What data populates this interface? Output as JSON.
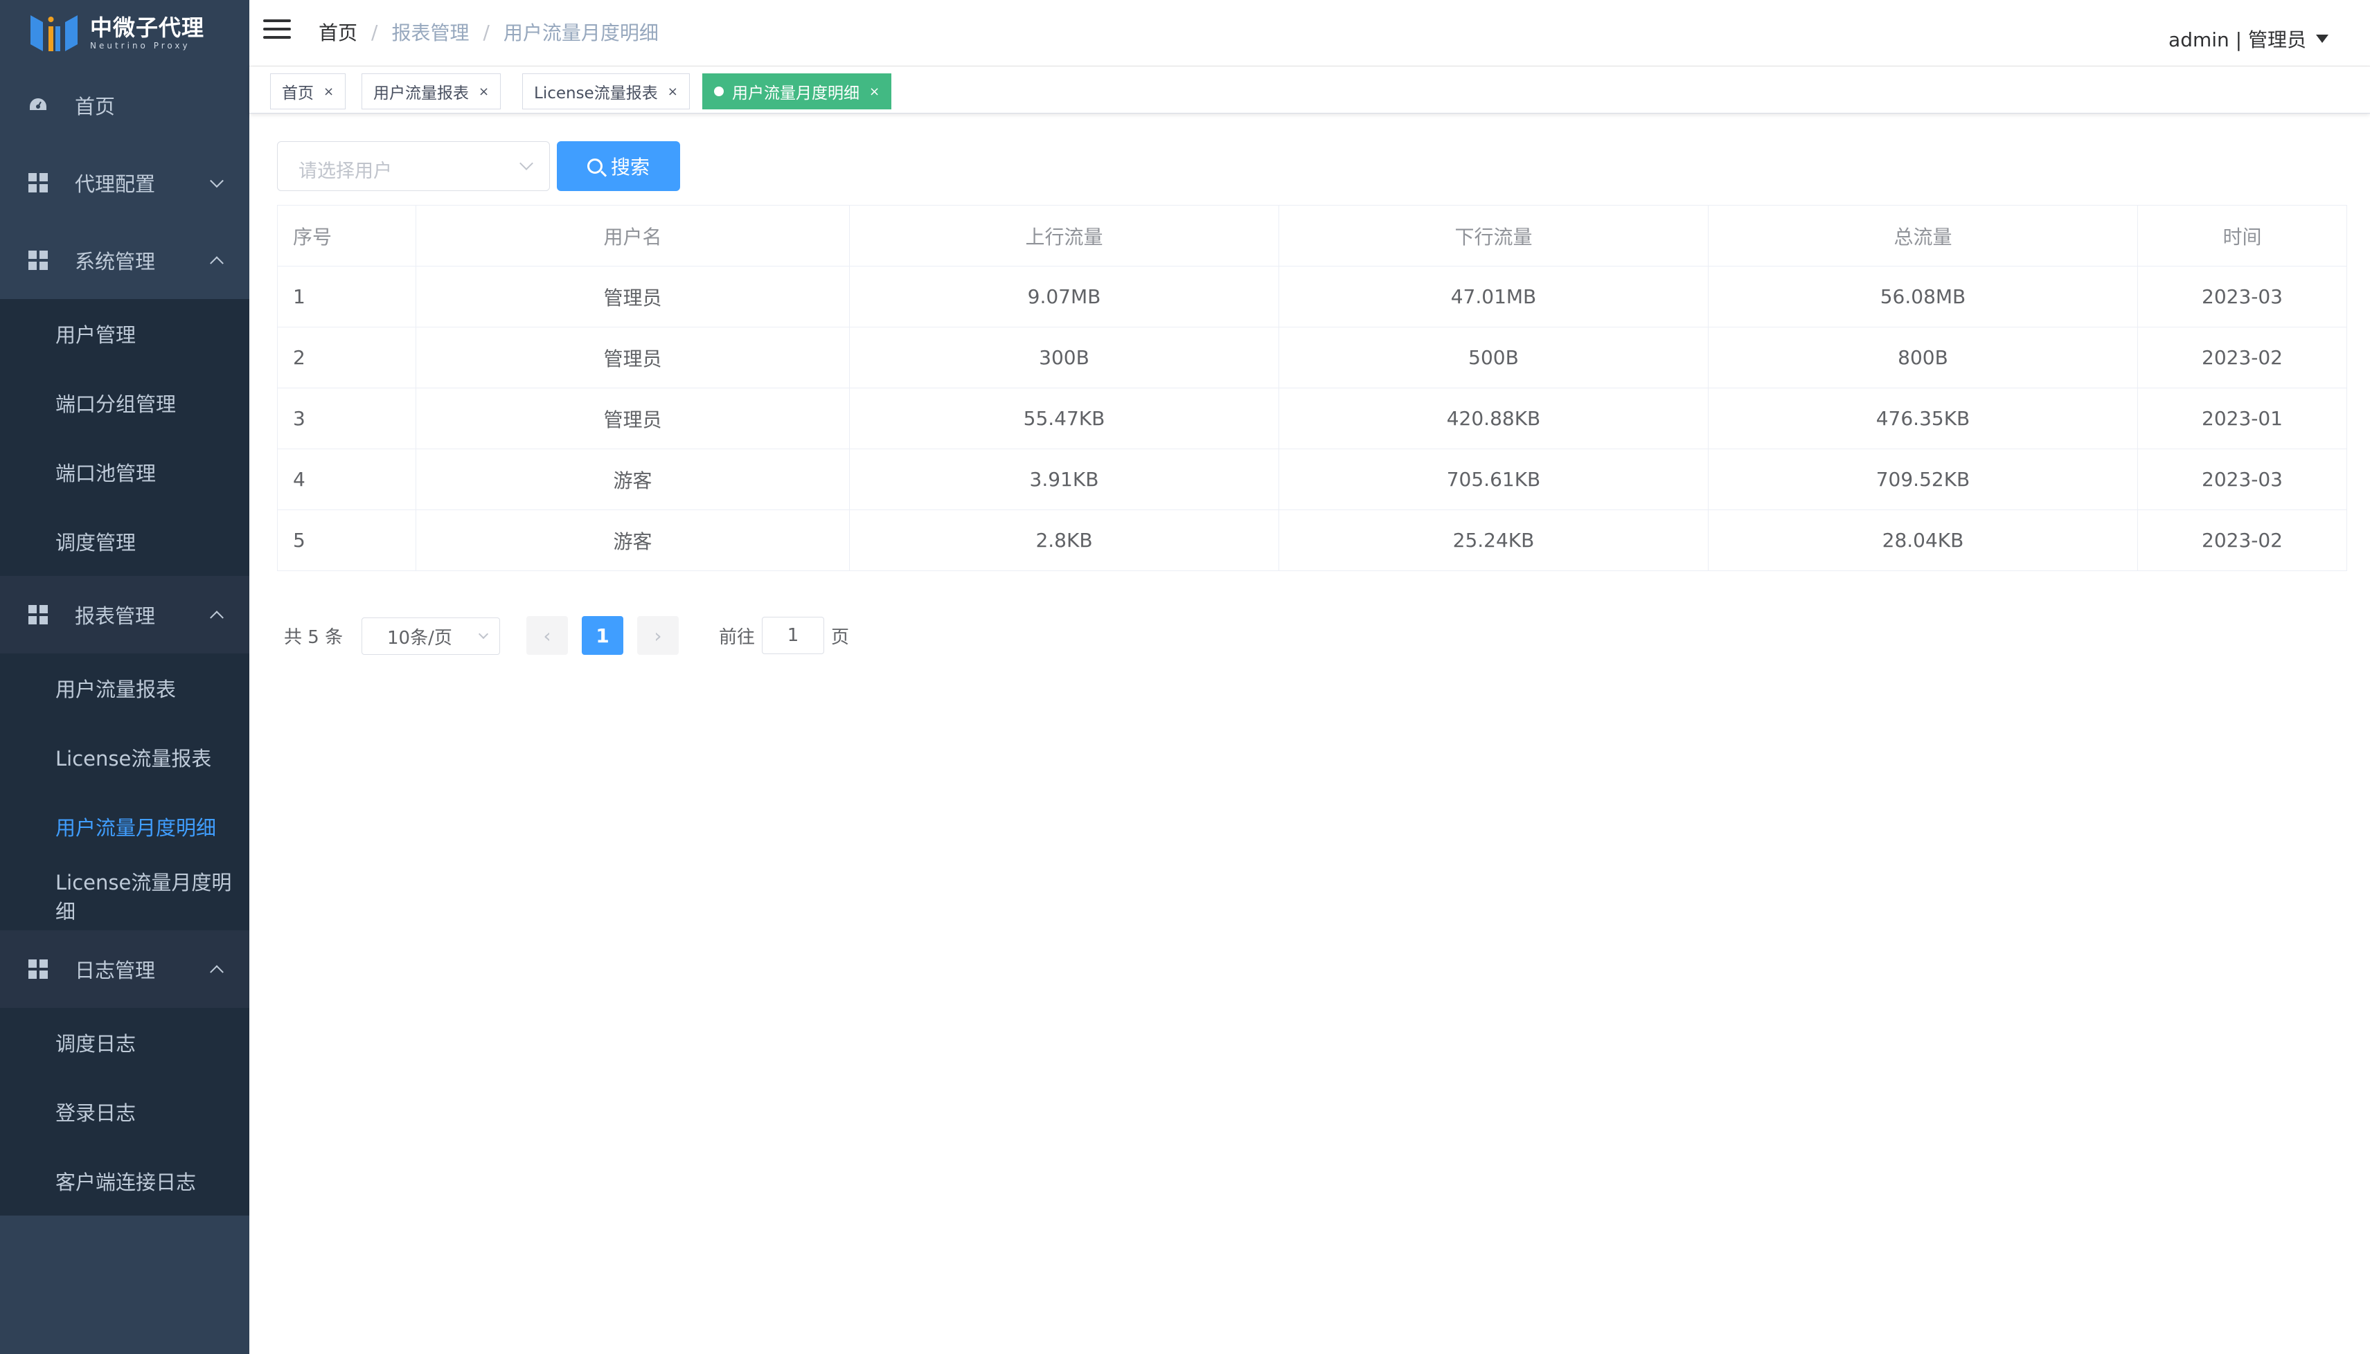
{
  "app": {
    "logo_cn": "中微子代理",
    "logo_en": "Neutrino Proxy"
  },
  "sidebar": {
    "home": "首页",
    "proxy_config": "代理配置",
    "system": {
      "label": "系统管理",
      "items": [
        "用户管理",
        "端口分组管理",
        "端口池管理",
        "调度管理"
      ]
    },
    "report": {
      "label": "报表管理",
      "items": [
        "用户流量报表",
        "License流量报表",
        "用户流量月度明细",
        "License流量月度明细"
      ],
      "active_index": 2
    },
    "log": {
      "label": "日志管理",
      "items": [
        "调度日志",
        "登录日志",
        "客户端连接日志"
      ]
    }
  },
  "header": {
    "breadcrumb": [
      "首页",
      "报表管理",
      "用户流量月度明细"
    ],
    "separator": "/",
    "user": "admin | 管理员"
  },
  "tags": [
    {
      "label": "首页",
      "active": false
    },
    {
      "label": "用户流量报表",
      "active": false
    },
    {
      "label": "License流量报表",
      "active": false
    },
    {
      "label": "用户流量月度明细",
      "active": true
    }
  ],
  "filter": {
    "user_placeholder": "请选择用户",
    "search_label": "搜索"
  },
  "table": {
    "columns": [
      "序号",
      "用户名",
      "上行流量",
      "下行流量",
      "总流量",
      "时间"
    ],
    "rows": [
      [
        "1",
        "管理员",
        "9.07MB",
        "47.01MB",
        "56.08MB",
        "2023-03"
      ],
      [
        "2",
        "管理员",
        "300B",
        "500B",
        "800B",
        "2023-02"
      ],
      [
        "3",
        "管理员",
        "55.47KB",
        "420.88KB",
        "476.35KB",
        "2023-01"
      ],
      [
        "4",
        "游客",
        "3.91KB",
        "705.61KB",
        "709.52KB",
        "2023-03"
      ],
      [
        "5",
        "游客",
        "2.8KB",
        "25.24KB",
        "28.04KB",
        "2023-02"
      ]
    ]
  },
  "pagination": {
    "total": "共 5 条",
    "page_size": "10条/页",
    "current_page": "1",
    "goto_prefix": "前往",
    "goto_value": "1",
    "goto_suffix": "页"
  },
  "colors": {
    "sidebar_bg": "#304156",
    "submenu_bg": "#1f2d3d",
    "primary": "#409eff",
    "active_tag": "#42b983"
  }
}
